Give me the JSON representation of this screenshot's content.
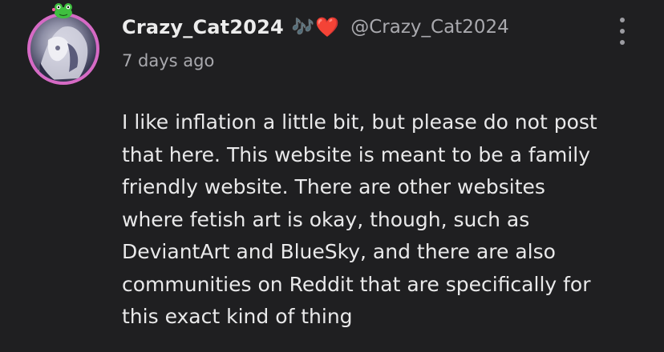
{
  "comment": {
    "username": "Crazy_Cat2024",
    "handle": "@Crazy_Cat2024",
    "decorations": {
      "note": "🎶",
      "heart": "❤️"
    },
    "timestamp": "7 days ago",
    "body_lines": [
      "I like inflation a little bit, but please do not post",
      "that here. This website is meant to be a family",
      "friendly website. There are other websites",
      "where fetish art is okay, though, such as",
      "DeviantArt and BlueSky, and there are also",
      "communities on Reddit that are specifically for",
      "this exact kind of thing"
    ],
    "avatar_ring_color": "#d66ac5",
    "icons": {
      "menu": "more-vertical-icon",
      "badge": "frog-icon"
    }
  }
}
